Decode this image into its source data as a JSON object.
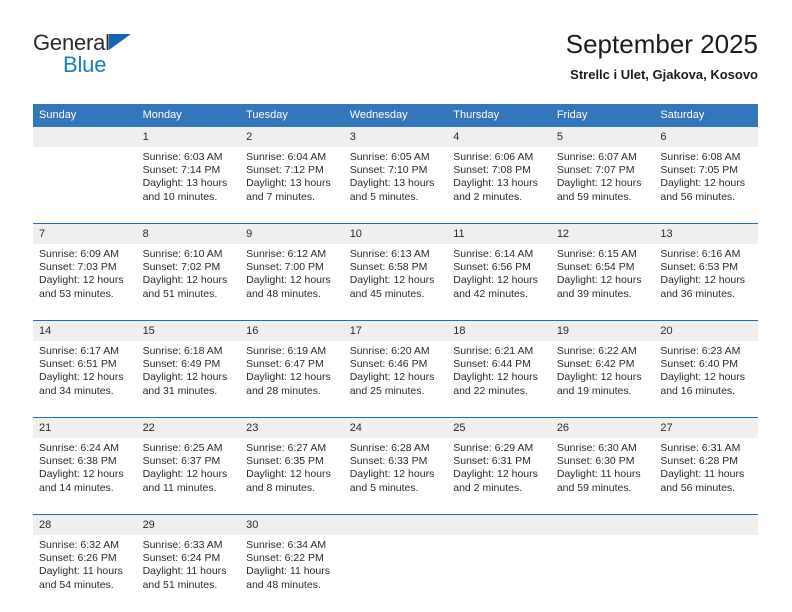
{
  "brand": {
    "name_part1": "General",
    "name_part2": "Blue",
    "accent_color": "#1b79c9",
    "triangle_color": "#1565b0"
  },
  "header": {
    "title": "September 2025",
    "subtitle": "Strellc i Ulet, Gjakova, Kosovo",
    "header_bg": "#3277bc",
    "daynum_bg": "#efefef",
    "divider_color": "#1f6fb2"
  },
  "weekdays": [
    "Sunday",
    "Monday",
    "Tuesday",
    "Wednesday",
    "Thursday",
    "Friday",
    "Saturday"
  ],
  "weeks": [
    [
      {
        "day": "",
        "lines": []
      },
      {
        "day": "1",
        "lines": [
          "Sunrise: 6:03 AM",
          "Sunset: 7:14 PM",
          "Daylight: 13 hours and 10 minutes."
        ]
      },
      {
        "day": "2",
        "lines": [
          "Sunrise: 6:04 AM",
          "Sunset: 7:12 PM",
          "Daylight: 13 hours and 7 minutes."
        ]
      },
      {
        "day": "3",
        "lines": [
          "Sunrise: 6:05 AM",
          "Sunset: 7:10 PM",
          "Daylight: 13 hours and 5 minutes."
        ]
      },
      {
        "day": "4",
        "lines": [
          "Sunrise: 6:06 AM",
          "Sunset: 7:08 PM",
          "Daylight: 13 hours and 2 minutes."
        ]
      },
      {
        "day": "5",
        "lines": [
          "Sunrise: 6:07 AM",
          "Sunset: 7:07 PM",
          "Daylight: 12 hours and 59 minutes."
        ]
      },
      {
        "day": "6",
        "lines": [
          "Sunrise: 6:08 AM",
          "Sunset: 7:05 PM",
          "Daylight: 12 hours and 56 minutes."
        ]
      }
    ],
    [
      {
        "day": "7",
        "lines": [
          "Sunrise: 6:09 AM",
          "Sunset: 7:03 PM",
          "Daylight: 12 hours and 53 minutes."
        ]
      },
      {
        "day": "8",
        "lines": [
          "Sunrise: 6:10 AM",
          "Sunset: 7:02 PM",
          "Daylight: 12 hours and 51 minutes."
        ]
      },
      {
        "day": "9",
        "lines": [
          "Sunrise: 6:12 AM",
          "Sunset: 7:00 PM",
          "Daylight: 12 hours and 48 minutes."
        ]
      },
      {
        "day": "10",
        "lines": [
          "Sunrise: 6:13 AM",
          "Sunset: 6:58 PM",
          "Daylight: 12 hours and 45 minutes."
        ]
      },
      {
        "day": "11",
        "lines": [
          "Sunrise: 6:14 AM",
          "Sunset: 6:56 PM",
          "Daylight: 12 hours and 42 minutes."
        ]
      },
      {
        "day": "12",
        "lines": [
          "Sunrise: 6:15 AM",
          "Sunset: 6:54 PM",
          "Daylight: 12 hours and 39 minutes."
        ]
      },
      {
        "day": "13",
        "lines": [
          "Sunrise: 6:16 AM",
          "Sunset: 6:53 PM",
          "Daylight: 12 hours and 36 minutes."
        ]
      }
    ],
    [
      {
        "day": "14",
        "lines": [
          "Sunrise: 6:17 AM",
          "Sunset: 6:51 PM",
          "Daylight: 12 hours and 34 minutes."
        ]
      },
      {
        "day": "15",
        "lines": [
          "Sunrise: 6:18 AM",
          "Sunset: 6:49 PM",
          "Daylight: 12 hours and 31 minutes."
        ]
      },
      {
        "day": "16",
        "lines": [
          "Sunrise: 6:19 AM",
          "Sunset: 6:47 PM",
          "Daylight: 12 hours and 28 minutes."
        ]
      },
      {
        "day": "17",
        "lines": [
          "Sunrise: 6:20 AM",
          "Sunset: 6:46 PM",
          "Daylight: 12 hours and 25 minutes."
        ]
      },
      {
        "day": "18",
        "lines": [
          "Sunrise: 6:21 AM",
          "Sunset: 6:44 PM",
          "Daylight: 12 hours and 22 minutes."
        ]
      },
      {
        "day": "19",
        "lines": [
          "Sunrise: 6:22 AM",
          "Sunset: 6:42 PM",
          "Daylight: 12 hours and 19 minutes."
        ]
      },
      {
        "day": "20",
        "lines": [
          "Sunrise: 6:23 AM",
          "Sunset: 6:40 PM",
          "Daylight: 12 hours and 16 minutes."
        ]
      }
    ],
    [
      {
        "day": "21",
        "lines": [
          "Sunrise: 6:24 AM",
          "Sunset: 6:38 PM",
          "Daylight: 12 hours and 14 minutes."
        ]
      },
      {
        "day": "22",
        "lines": [
          "Sunrise: 6:25 AM",
          "Sunset: 6:37 PM",
          "Daylight: 12 hours and 11 minutes."
        ]
      },
      {
        "day": "23",
        "lines": [
          "Sunrise: 6:27 AM",
          "Sunset: 6:35 PM",
          "Daylight: 12 hours and 8 minutes."
        ]
      },
      {
        "day": "24",
        "lines": [
          "Sunrise: 6:28 AM",
          "Sunset: 6:33 PM",
          "Daylight: 12 hours and 5 minutes."
        ]
      },
      {
        "day": "25",
        "lines": [
          "Sunrise: 6:29 AM",
          "Sunset: 6:31 PM",
          "Daylight: 12 hours and 2 minutes."
        ]
      },
      {
        "day": "26",
        "lines": [
          "Sunrise: 6:30 AM",
          "Sunset: 6:30 PM",
          "Daylight: 11 hours and 59 minutes."
        ]
      },
      {
        "day": "27",
        "lines": [
          "Sunrise: 6:31 AM",
          "Sunset: 6:28 PM",
          "Daylight: 11 hours and 56 minutes."
        ]
      }
    ],
    [
      {
        "day": "28",
        "lines": [
          "Sunrise: 6:32 AM",
          "Sunset: 6:26 PM",
          "Daylight: 11 hours and 54 minutes."
        ]
      },
      {
        "day": "29",
        "lines": [
          "Sunrise: 6:33 AM",
          "Sunset: 6:24 PM",
          "Daylight: 11 hours and 51 minutes."
        ]
      },
      {
        "day": "30",
        "lines": [
          "Sunrise: 6:34 AM",
          "Sunset: 6:22 PM",
          "Daylight: 11 hours and 48 minutes."
        ]
      },
      {
        "day": "",
        "lines": []
      },
      {
        "day": "",
        "lines": []
      },
      {
        "day": "",
        "lines": []
      },
      {
        "day": "",
        "lines": []
      }
    ]
  ]
}
